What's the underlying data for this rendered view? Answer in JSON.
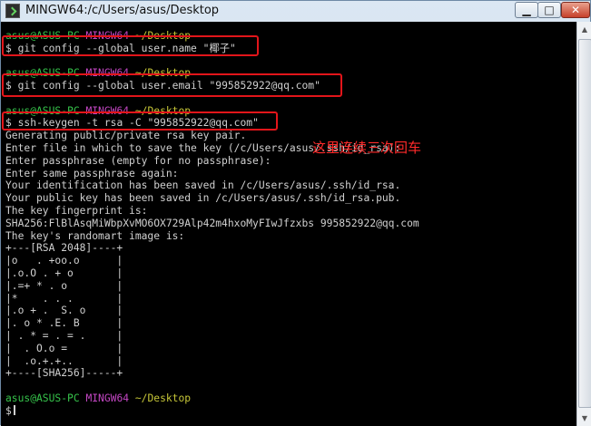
{
  "window": {
    "title": "MINGW64:/c/Users/asus/Desktop",
    "controls": {
      "minimize": "▁",
      "maximize": "□",
      "close": "✕"
    }
  },
  "prompt": {
    "user_host": "asus@ASUS-PC",
    "system": "MINGW64",
    "path": "~/Desktop",
    "symbol": "$"
  },
  "commands": [
    "git config --global user.name \"椰子\"",
    "git config --global user.email \"995852922@qq.com\"",
    "ssh-keygen -t rsa -C \"995852922@qq.com\""
  ],
  "output": [
    "Generating public/private rsa key pair.",
    "Enter file in which to save the key (/c/Users/asus/.ssh/id_rsa):",
    "Enter passphrase (empty for no passphrase):",
    "Enter same passphrase again:",
    "Your identification has been saved in /c/Users/asus/.ssh/id_rsa.",
    "Your public key has been saved in /c/Users/asus/.ssh/id_rsa.pub.",
    "The key fingerprint is:",
    "SHA256:FlBlAsqMiWbpXvMO6OX729Alp42m4hxoMyFIwJfzxbs 995852922@qq.com",
    "The key's randomart image is:",
    "+---[RSA 2048]----+",
    "|o   . +oo.o      |",
    "|.o.O . + o       |",
    "|.=+ * . o        |",
    "|*    . . .       |",
    "|.o + .  S. o     |",
    "|. o * .E. B      |",
    "| . * = . = .     |",
    "|  . O.o =        |",
    "|  .o.+.+..       |",
    "+----[SHA256]-----+"
  ],
  "annotation": "这里连续三次回车"
}
